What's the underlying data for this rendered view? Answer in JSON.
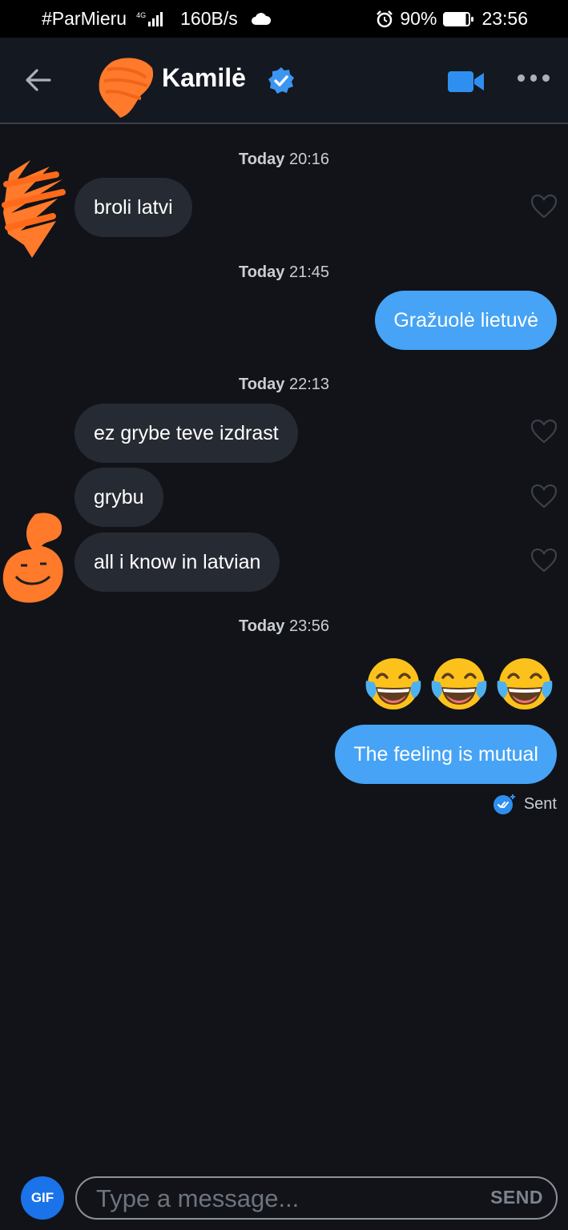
{
  "status_bar": {
    "carrier": "#ParMieru",
    "network_type": "4G",
    "speed": "160B/s",
    "battery": "90%",
    "time": "23:56",
    "icons": [
      "signal-icon",
      "cloud-icon",
      "alarm-icon",
      "battery-icon"
    ]
  },
  "header": {
    "contact_name": "Kamilė",
    "verified": true,
    "icons": [
      "back-arrow-icon",
      "verified-badge-icon",
      "video-call-icon",
      "more-options-icon"
    ]
  },
  "messages": [
    {
      "type": "timestamp",
      "day": "Today",
      "time": "20:16"
    },
    {
      "type": "incoming",
      "text": "broli latvi"
    },
    {
      "type": "timestamp",
      "day": "Today",
      "time": "21:45"
    },
    {
      "type": "outgoing",
      "text": "Gražuolė lietuvė"
    },
    {
      "type": "timestamp",
      "day": "Today",
      "time": "22:13"
    },
    {
      "type": "incoming",
      "text": "ez grybe teve izdrast"
    },
    {
      "type": "incoming",
      "text": "grybu"
    },
    {
      "type": "incoming",
      "text": "all i know in latvian"
    },
    {
      "type": "timestamp",
      "day": "Today",
      "time": "23:56"
    },
    {
      "type": "outgoing-emoji",
      "emoji": [
        "face-with-tears-of-joy",
        "face-with-tears-of-joy",
        "face-with-tears-of-joy"
      ]
    },
    {
      "type": "outgoing",
      "text": "The feeling is mutual"
    }
  ],
  "delivery_status": "Sent",
  "composer": {
    "gif_label": "GIF",
    "placeholder": "Type a message...",
    "send_label": "SEND"
  },
  "colors": {
    "background": "#111318",
    "incoming_bubble": "#262a33",
    "outgoing_bubble": "#46a3f5",
    "accent": "#1a73e8",
    "redaction": "#ff7a2a"
  }
}
